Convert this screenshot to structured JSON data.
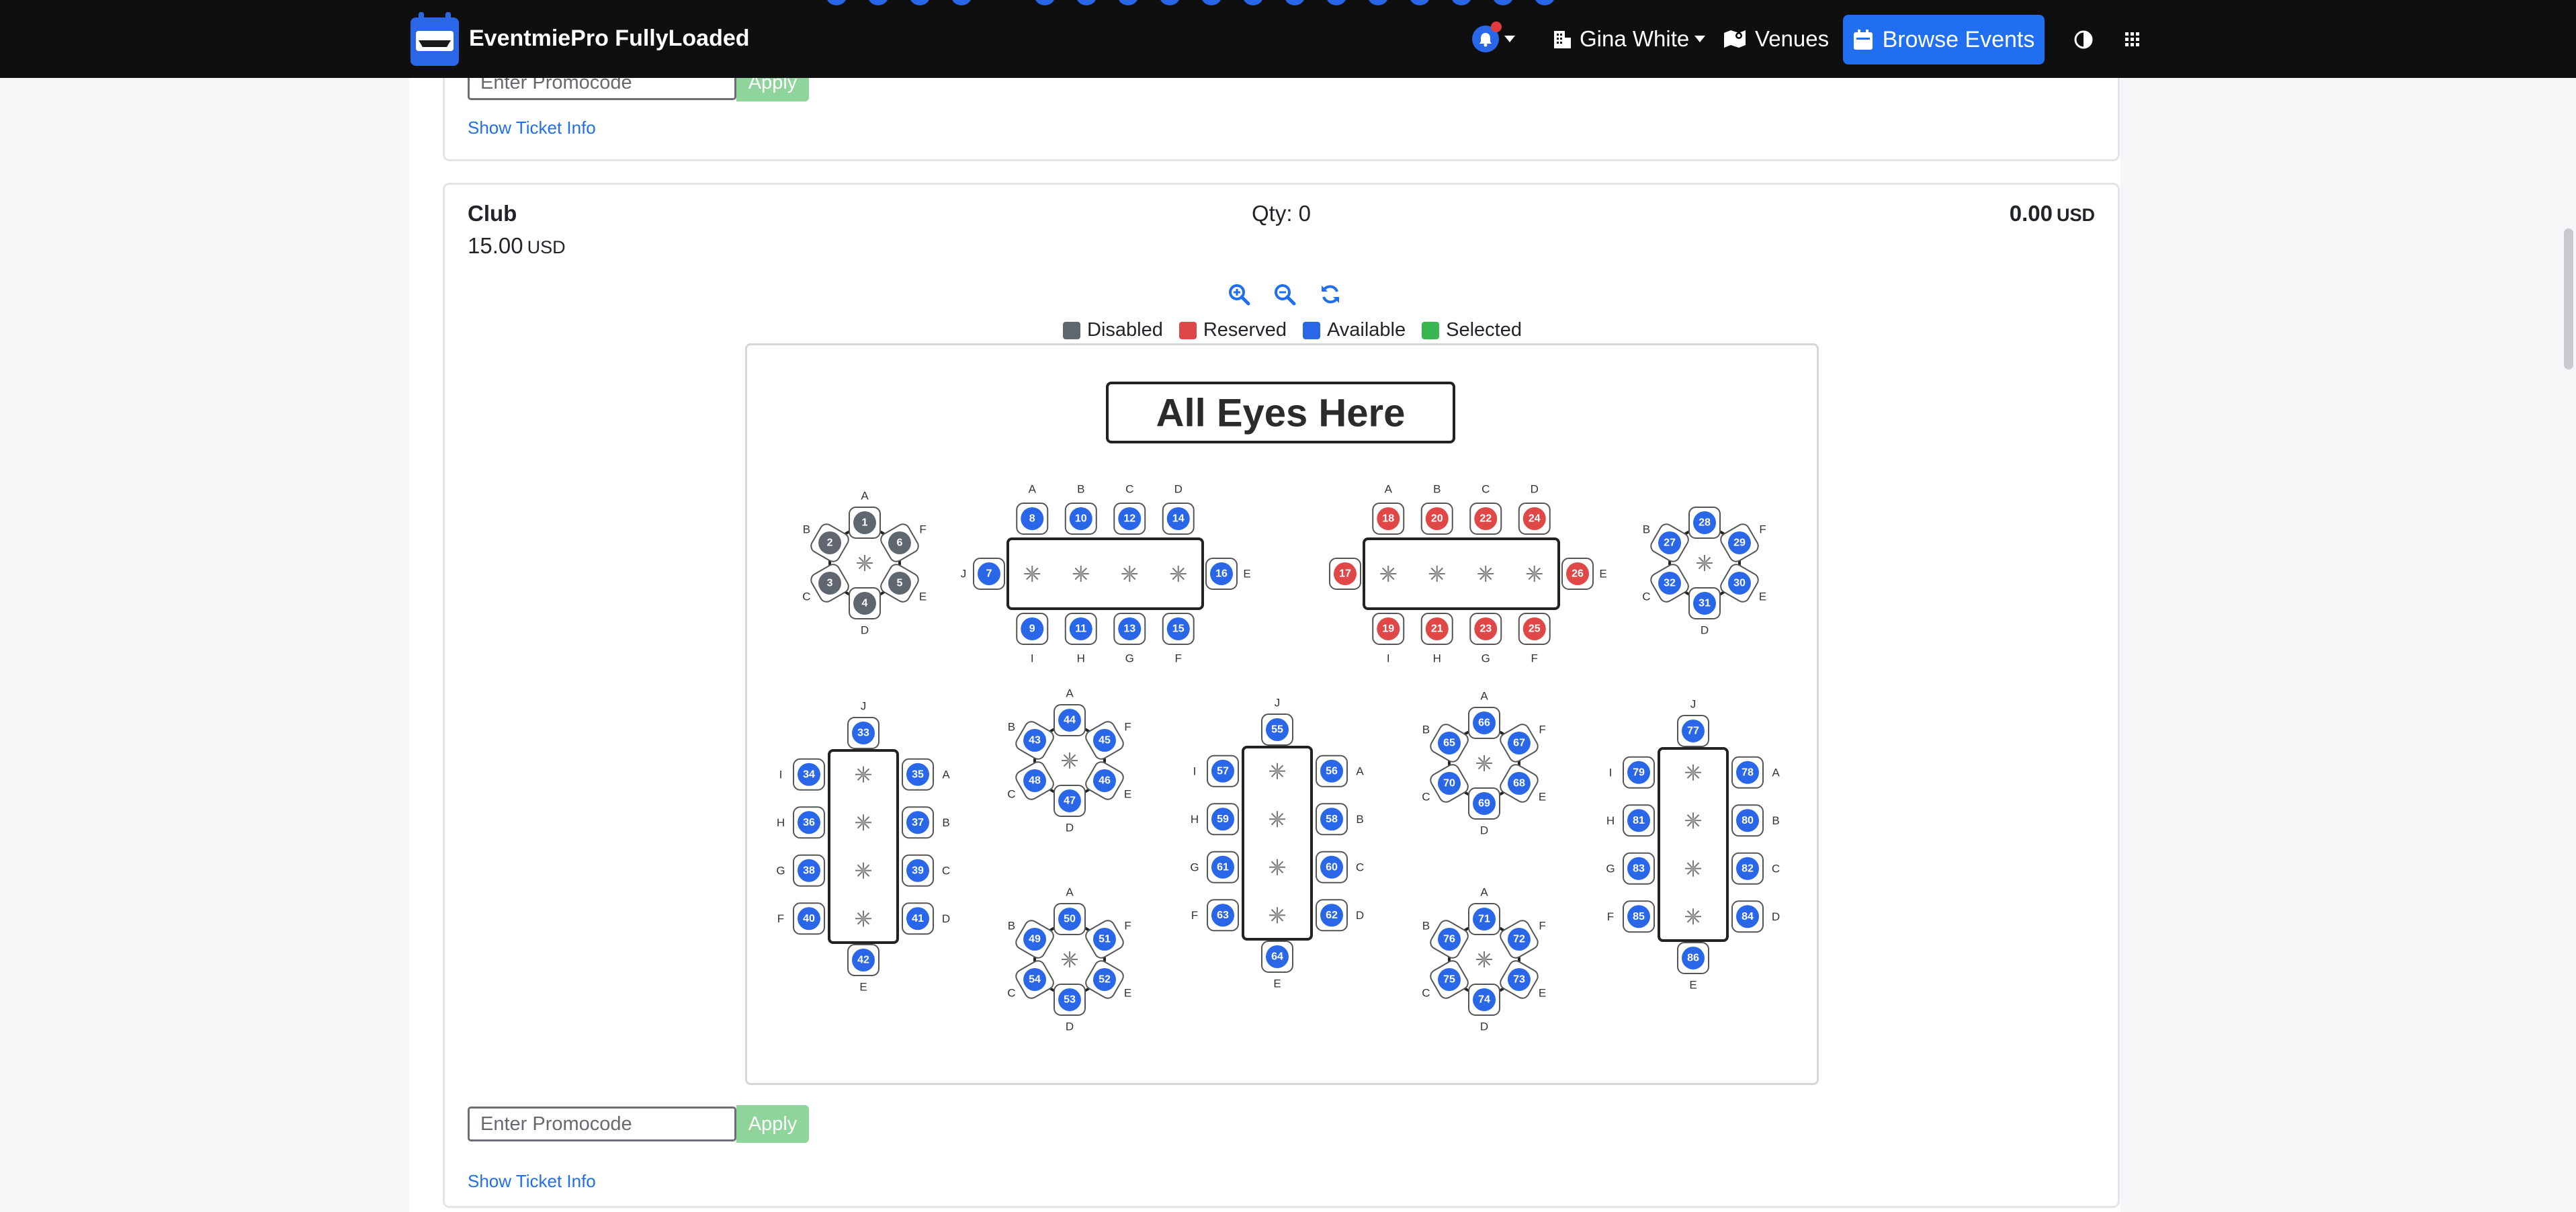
{
  "app": {
    "title": "EventmiePro FullyLoaded"
  },
  "nav": {
    "user_name": "Gina White",
    "venues_label": "Venues",
    "browse_events_label": "Browse Events"
  },
  "ticket_prev": {
    "promo_placeholder": "Enter Promocode",
    "apply_label": "Apply",
    "info_link": "Show Ticket Info"
  },
  "ticket": {
    "name": "Club",
    "price": "15.00",
    "price_currency": "USD",
    "qty_label": "Qty: 0",
    "total": "0.00",
    "total_currency": "USD",
    "promo_placeholder": "Enter Promocode",
    "apply_label": "Apply",
    "info_link": "Show Ticket Info"
  },
  "legend": [
    {
      "label": "Disabled",
      "color": "#5f6670"
    },
    {
      "label": "Reserved",
      "color": "#e04848"
    },
    {
      "label": "Available",
      "color": "#2a67e8"
    },
    {
      "label": "Selected",
      "color": "#39b552"
    }
  ],
  "map": {
    "stage_label": "All Eyes Here",
    "colors": {
      "disabled": "#5f6670",
      "reserved": "#e04848",
      "available": "#2a67e8"
    },
    "tables": [
      {
        "type": "round",
        "seats": [
          {
            "n": "1",
            "s": "disabled",
            "l": "A"
          },
          {
            "n": "6",
            "s": "disabled",
            "l": "F"
          },
          {
            "n": "5",
            "s": "disabled",
            "l": "E"
          },
          {
            "n": "4",
            "s": "disabled",
            "l": "D"
          },
          {
            "n": "3",
            "s": "disabled",
            "l": "C"
          },
          {
            "n": "2",
            "s": "disabled",
            "l": "B"
          }
        ]
      },
      {
        "type": "long-h",
        "top": [
          {
            "n": "8",
            "s": "available",
            "l": "A"
          },
          {
            "n": "10",
            "s": "available",
            "l": "B"
          },
          {
            "n": "12",
            "s": "available",
            "l": "C"
          },
          {
            "n": "14",
            "s": "available",
            "l": "D"
          }
        ],
        "bottom": [
          {
            "n": "9",
            "s": "available",
            "l": "I"
          },
          {
            "n": "11",
            "s": "available",
            "l": "H"
          },
          {
            "n": "13",
            "s": "available",
            "l": "G"
          },
          {
            "n": "15",
            "s": "available",
            "l": "F"
          }
        ],
        "left": {
          "n": "7",
          "s": "available",
          "l": "J"
        },
        "right": {
          "n": "16",
          "s": "available",
          "l": "E"
        }
      },
      {
        "type": "long-h",
        "top": [
          {
            "n": "18",
            "s": "reserved",
            "l": "A"
          },
          {
            "n": "20",
            "s": "reserved",
            "l": "B"
          },
          {
            "n": "22",
            "s": "reserved",
            "l": "C"
          },
          {
            "n": "24",
            "s": "reserved",
            "l": "D"
          }
        ],
        "bottom": [
          {
            "n": "19",
            "s": "reserved",
            "l": "I"
          },
          {
            "n": "21",
            "s": "reserved",
            "l": "H"
          },
          {
            "n": "23",
            "s": "reserved",
            "l": "G"
          },
          {
            "n": "25",
            "s": "reserved",
            "l": "F"
          }
        ],
        "left": {
          "n": "17",
          "s": "reserved",
          "l": ""
        },
        "right": {
          "n": "26",
          "s": "reserved",
          "l": "E"
        }
      },
      {
        "type": "round",
        "seats": [
          {
            "n": "28",
            "s": "available",
            "l": ""
          },
          {
            "n": "29",
            "s": "available",
            "l": "F"
          },
          {
            "n": "30",
            "s": "available",
            "l": "E"
          },
          {
            "n": "31",
            "s": "available",
            "l": "D"
          },
          {
            "n": "32",
            "s": "available",
            "l": "C"
          },
          {
            "n": "27",
            "s": "available",
            "l": "B"
          }
        ]
      },
      {
        "type": "long-v",
        "top": {
          "n": "33",
          "s": "available",
          "l": "J"
        },
        "bottom": {
          "n": "42",
          "s": "available",
          "l": "E"
        },
        "left": [
          {
            "n": "34",
            "s": "available",
            "l": "I"
          },
          {
            "n": "36",
            "s": "available",
            "l": "H"
          },
          {
            "n": "38",
            "s": "available",
            "l": "G"
          },
          {
            "n": "40",
            "s": "available",
            "l": "F"
          }
        ],
        "right": [
          {
            "n": "35",
            "s": "available",
            "l": "A"
          },
          {
            "n": "37",
            "s": "available",
            "l": "B"
          },
          {
            "n": "39",
            "s": "available",
            "l": "C"
          },
          {
            "n": "41",
            "s": "available",
            "l": "D"
          }
        ]
      },
      {
        "type": "round",
        "seats": [
          {
            "n": "44",
            "s": "available",
            "l": "A"
          },
          {
            "n": "45",
            "s": "available",
            "l": "F"
          },
          {
            "n": "46",
            "s": "available",
            "l": "E"
          },
          {
            "n": "47",
            "s": "available",
            "l": "D"
          },
          {
            "n": "48",
            "s": "available",
            "l": "C"
          },
          {
            "n": "43",
            "s": "available",
            "l": "B"
          }
        ]
      },
      {
        "type": "round",
        "seats": [
          {
            "n": "50",
            "s": "available",
            "l": "A"
          },
          {
            "n": "51",
            "s": "available",
            "l": "F"
          },
          {
            "n": "52",
            "s": "available",
            "l": "E"
          },
          {
            "n": "53",
            "s": "available",
            "l": "D"
          },
          {
            "n": "54",
            "s": "available",
            "l": "C"
          },
          {
            "n": "49",
            "s": "available",
            "l": "B"
          }
        ]
      },
      {
        "type": "long-v",
        "top": {
          "n": "55",
          "s": "available",
          "l": "J"
        },
        "bottom": {
          "n": "64",
          "s": "available",
          "l": "E"
        },
        "left": [
          {
            "n": "57",
            "s": "available",
            "l": "I"
          },
          {
            "n": "59",
            "s": "available",
            "l": "H"
          },
          {
            "n": "61",
            "s": "available",
            "l": "G"
          },
          {
            "n": "63",
            "s": "available",
            "l": "F"
          }
        ],
        "right": [
          {
            "n": "56",
            "s": "available",
            "l": "A"
          },
          {
            "n": "58",
            "s": "available",
            "l": "B"
          },
          {
            "n": "60",
            "s": "available",
            "l": "C"
          },
          {
            "n": "62",
            "s": "available",
            "l": "D"
          }
        ]
      },
      {
        "type": "round",
        "seats": [
          {
            "n": "66",
            "s": "available",
            "l": "A"
          },
          {
            "n": "67",
            "s": "available",
            "l": "F"
          },
          {
            "n": "68",
            "s": "available",
            "l": "E"
          },
          {
            "n": "69",
            "s": "available",
            "l": "D"
          },
          {
            "n": "70",
            "s": "available",
            "l": "C"
          },
          {
            "n": "65",
            "s": "available",
            "l": "B"
          }
        ]
      },
      {
        "type": "round",
        "seats": [
          {
            "n": "71",
            "s": "available",
            "l": "A"
          },
          {
            "n": "72",
            "s": "available",
            "l": "F"
          },
          {
            "n": "73",
            "s": "available",
            "l": "E"
          },
          {
            "n": "74",
            "s": "available",
            "l": "D"
          },
          {
            "n": "75",
            "s": "available",
            "l": "C"
          },
          {
            "n": "76",
            "s": "available",
            "l": "B"
          }
        ]
      },
      {
        "type": "long-v",
        "top": {
          "n": "77",
          "s": "available",
          "l": "J"
        },
        "bottom": {
          "n": "86",
          "s": "available",
          "l": "E"
        },
        "left": [
          {
            "n": "79",
            "s": "available",
            "l": "I"
          },
          {
            "n": "81",
            "s": "available",
            "l": "H"
          },
          {
            "n": "83",
            "s": "available",
            "l": "G"
          },
          {
            "n": "85",
            "s": "available",
            "l": "F"
          }
        ],
        "right": [
          {
            "n": "78",
            "s": "available",
            "l": "A"
          },
          {
            "n": "80",
            "s": "available",
            "l": "B"
          },
          {
            "n": "82",
            "s": "available",
            "l": "C"
          },
          {
            "n": "84",
            "s": "available",
            "l": "D"
          }
        ]
      }
    ]
  }
}
